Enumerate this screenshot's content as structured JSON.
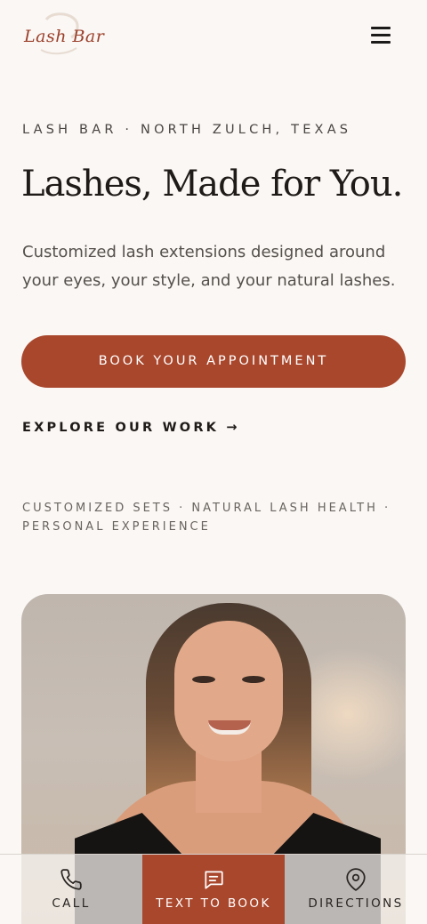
{
  "header": {
    "logo_text": "Lash Bar",
    "menu_label": "Menu"
  },
  "hero": {
    "eyebrow": "LASH BAR · NORTH ZULCH, TEXAS",
    "headline": "Lashes, Made for You.",
    "subtext": "Customized lash extensions designed around your eyes, your style, and your natural lashes.",
    "book_label": "BOOK YOUR APPOINTMENT",
    "explore_label": "EXPLORE OUR WORK →",
    "features": "CUSTOMIZED SETS · NATURAL LASH HEALTH · PERSONAL EXPERIENCE"
  },
  "bottom_bar": {
    "items": [
      {
        "label": "CALL",
        "icon": "phone-icon"
      },
      {
        "label": "TEXT TO BOOK",
        "icon": "message-icon"
      },
      {
        "label": "DIRECTIONS",
        "icon": "map-pin-icon"
      }
    ]
  },
  "colors": {
    "background": "#faf7f4",
    "accent": "#a9472d",
    "text": "#1f1b19"
  }
}
